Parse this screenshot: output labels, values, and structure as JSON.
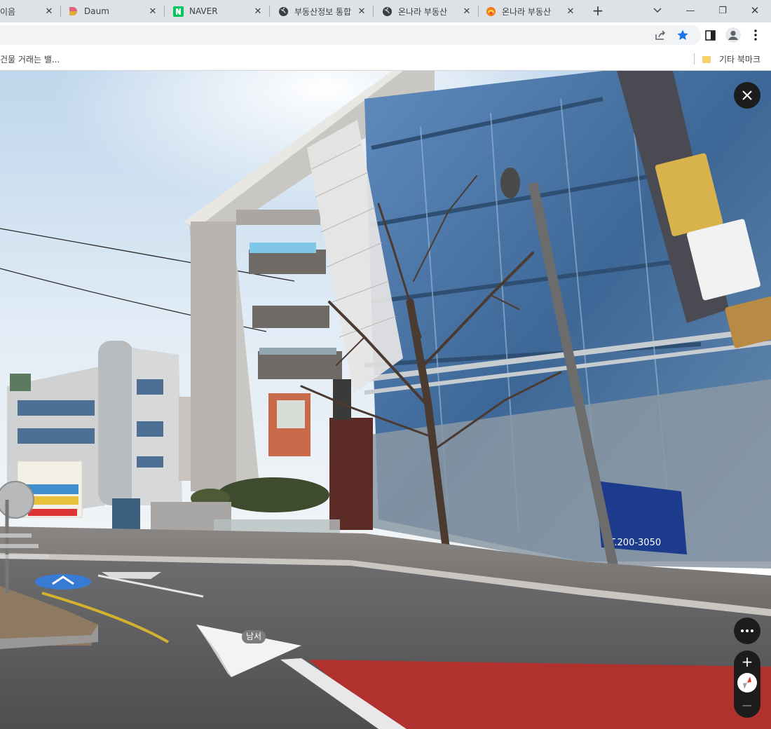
{
  "browser": {
    "tabs": [
      {
        "title": "이음",
        "favicon": "none"
      },
      {
        "title": "Daum",
        "favicon": "daum-logo"
      },
      {
        "title": "NAVER",
        "favicon": "naver-logo"
      },
      {
        "title": "부동산정보 통합",
        "favicon": "globe-icon"
      },
      {
        "title": "온나라 부동산",
        "favicon": "globe-icon"
      },
      {
        "title": "온나라 부동산",
        "favicon": "onnara-logo"
      }
    ],
    "new_tab_label": "+",
    "window_controls": {
      "minimize": "—",
      "restore": "❐",
      "close": "✕"
    }
  },
  "bookmarks": {
    "items": [
      {
        "label": "건물 거래는 밸..."
      }
    ],
    "other_label": "기타 북마크"
  },
  "street_view": {
    "direction_label": "남서",
    "controls": {
      "close": "close-icon",
      "more": "more-options-icon",
      "zoom_in": "+",
      "zoom_out": "−",
      "compass": "compass-icon"
    },
    "signs": {
      "banner_phone": "T.200-3050"
    }
  },
  "colors": {
    "tabstrip": "#dee1e6",
    "accent_star": "#1a73e8",
    "road_red": "#b0312e",
    "control_bg": "#1c1c1c"
  }
}
